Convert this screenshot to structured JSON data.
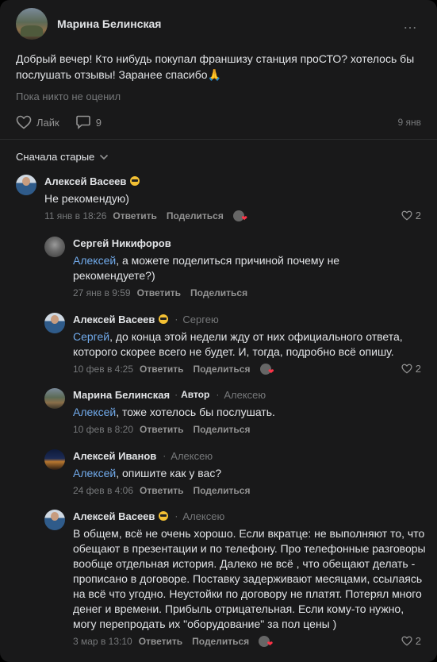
{
  "post": {
    "author": "Марина Белинская",
    "more_icon": "…",
    "text": "Добрый вечер! Кто нибудь покупал франшизу станция проСТО? хотелось бы послушать отзывы! Заранее спасибо🙏",
    "no_likes": "Пока никто не оценил",
    "like_label": "Лайк",
    "comments_count": "9",
    "date": "9 янв"
  },
  "sort_label": "Сначала старые",
  "comments": [
    {
      "name": "Алексей Васеев",
      "text": "Не рекомендую)",
      "date": "11 янв в 18:26",
      "reply_label": "Ответить",
      "share_label": "Поделиться",
      "likes": "2"
    },
    {
      "name": "Сергей Никифоров",
      "mention": "Алексей",
      "text": ", а можете поделиться причиной почему не рекомендуете?)",
      "date": "27 янв в 9:59",
      "reply_label": "Ответить",
      "share_label": "Поделиться"
    },
    {
      "name": "Алексей Васеев",
      "reply_to": "Сергею",
      "mention": "Сергей",
      "text": ", до конца этой недели жду от них официального ответа, которого скорее всего не будет. И, тогда, подробно всё опишу.",
      "date": "10 фев в 4:25",
      "reply_label": "Ответить",
      "share_label": "Поделиться",
      "likes": "2"
    },
    {
      "name": "Марина Белинская",
      "badge": "Автор",
      "reply_to": "Алексею",
      "mention": "Алексей",
      "text": ", тоже хотелось бы послушать.",
      "date": "10 фев в 8:20",
      "reply_label": "Ответить",
      "share_label": "Поделиться"
    },
    {
      "name": "Алексей Иванов",
      "reply_to": "Алексею",
      "mention": "Алексей",
      "text": ", опишите как у вас?",
      "date": "24 фев в 4:06",
      "reply_label": "Ответить",
      "share_label": "Поделиться"
    },
    {
      "name": "Алексей Васеев",
      "reply_to": "Алексею",
      "text": "В общем, всё не очень хорошо. Если вкратце: не выполняют то, что обещают в презентации и по телефону. Про телефонные разговоры вообще отдельная история. Далеко не всё , что обещают делать - прописано в договоре. Поставку задерживают месяцами, ссылаясь на всё что угодно. Неустойки по договору не платят. Потерял много денег и времени. Прибыль отрицательная. Если кому-то нужно, могу перепродать их \"оборудование\" за пол цены )",
      "date": "3 мар в 13:10",
      "reply_label": "Ответить",
      "share_label": "Поделиться",
      "likes": "2"
    }
  ],
  "colors": {
    "background": "#19191a",
    "text": "#e1e3e6",
    "secondary": "#76787a",
    "link": "#71aaeb",
    "heart": "#ff3347"
  }
}
